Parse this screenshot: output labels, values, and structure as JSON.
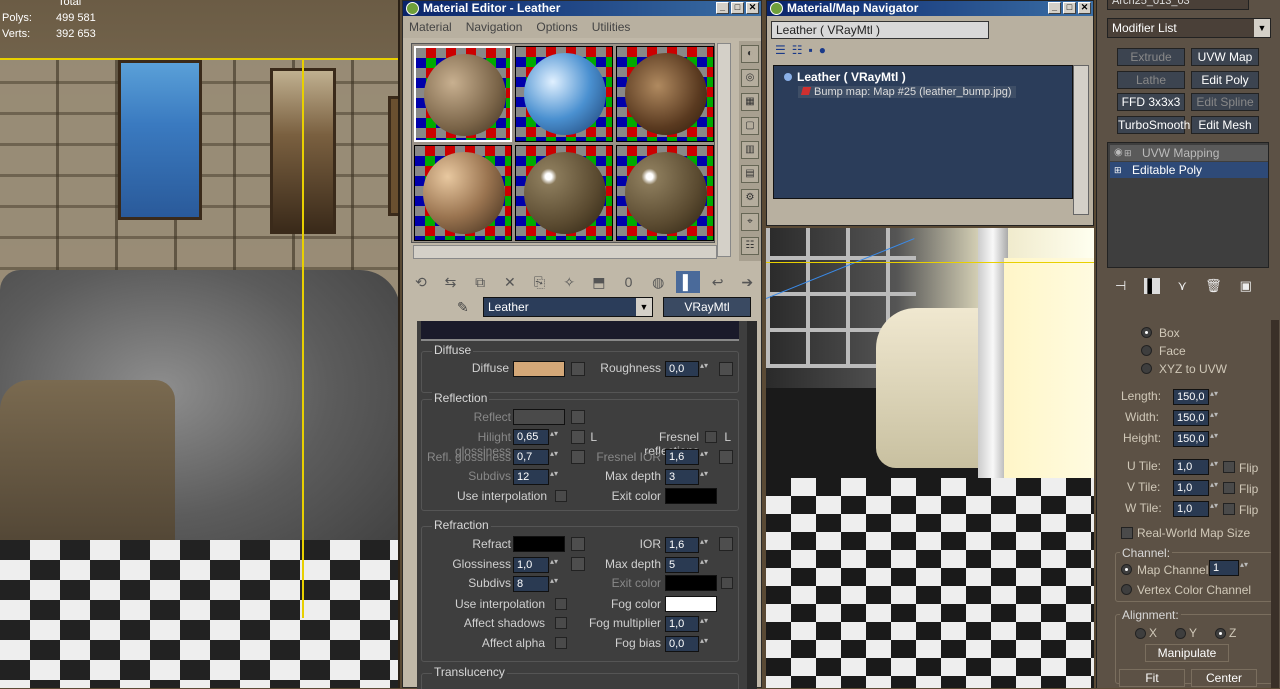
{
  "left_viewport": {
    "stats_header": "Total",
    "polys_label": "Polys:",
    "polys_value": "499 581",
    "verts_label": "Verts:",
    "verts_value": "392 653"
  },
  "material_editor": {
    "title": "Material Editor - Leather",
    "menu": [
      "Material",
      "Navigation",
      "Options",
      "Utilities"
    ],
    "material_name": "Leather",
    "material_type": "VRayMtl",
    "numeric_button": "0",
    "diffuse": {
      "group": "Diffuse",
      "diffuse_label": "Diffuse",
      "diffuse_color": "#d4a878",
      "roughness_label": "Roughness",
      "roughness_value": "0,0"
    },
    "reflection": {
      "group": "Reflection",
      "reflect_label": "Reflect",
      "hilight_label": "Hilight glossiness",
      "hilight_value": "0,65",
      "lock_label": "L",
      "fresnel_label": "Fresnel reflections",
      "fresnel_lock": "L",
      "refl_gloss_label": "Refl. glossiness",
      "refl_gloss_value": "0,7",
      "fresnel_ior_label": "Fresnel IOR",
      "fresnel_ior_value": "1,6",
      "subdivs_label": "Subdivs",
      "subdivs_value": "12",
      "max_depth_label": "Max depth",
      "max_depth_value": "3",
      "use_interp_label": "Use interpolation",
      "exit_color_label": "Exit color"
    },
    "refraction": {
      "group": "Refraction",
      "refract_label": "Refract",
      "ior_label": "IOR",
      "ior_value": "1,6",
      "glossiness_label": "Glossiness",
      "glossiness_value": "1,0",
      "max_depth_label": "Max depth",
      "max_depth_value": "5",
      "subdivs_label": "Subdivs",
      "subdivs_value": "8",
      "exit_color_label": "Exit color",
      "use_interp_label": "Use interpolation",
      "fog_color_label": "Fog color",
      "affect_shadows_label": "Affect shadows",
      "fog_mult_label": "Fog multiplier",
      "fog_mult_value": "1,0",
      "affect_alpha_label": "Affect alpha",
      "fog_bias_label": "Fog bias",
      "fog_bias_value": "0,0"
    },
    "translucency_group": "Translucency"
  },
  "navigator": {
    "title": "Material/Map Navigator",
    "search_value": "Leather  ( VRayMtl )",
    "tree": [
      {
        "label": "Leather  ( VRayMtl )"
      },
      {
        "label": "Bump map: Map #25 (leather_bump.jpg)"
      }
    ]
  },
  "modifier_panel": {
    "object_name": "Arch25_013_03",
    "modifier_list": "Modifier List",
    "buttons": [
      {
        "label": "Extrude",
        "dim": true
      },
      {
        "label": "UVW Map",
        "dim": false
      },
      {
        "label": "Lathe",
        "dim": true
      },
      {
        "label": "Edit Poly",
        "dim": false
      },
      {
        "label": "FFD 3x3x3",
        "dim": false
      },
      {
        "label": "Edit Spline",
        "dim": true
      },
      {
        "label": "TurboSmooth",
        "dim": false
      },
      {
        "label": "Edit Mesh",
        "dim": false
      }
    ],
    "stack": [
      "UVW Mapping",
      "Editable Poly"
    ],
    "mapping": [
      "Box",
      "Face",
      "XYZ to UVW"
    ],
    "length_label": "Length:",
    "length_value": "150,0",
    "width_label": "Width:",
    "width_value": "150,0",
    "height_label": "Height:",
    "height_value": "150,0",
    "u_tile_label": "U Tile:",
    "u_tile_value": "1,0",
    "v_tile_label": "V Tile:",
    "v_tile_value": "1,0",
    "w_tile_label": "W Tile:",
    "w_tile_value": "1,0",
    "flip_label": "Flip",
    "real_world_label": "Real-World Map Size",
    "channel_group": "Channel:",
    "map_channel_label": "Map Channel:",
    "map_channel_value": "1",
    "vertex_color_label": "Vertex Color Channel",
    "alignment_group": "Alignment:",
    "axes": [
      "X",
      "Y",
      "Z"
    ],
    "manipulate_label": "Manipulate",
    "fit_label": "Fit",
    "center_label": "Center"
  }
}
